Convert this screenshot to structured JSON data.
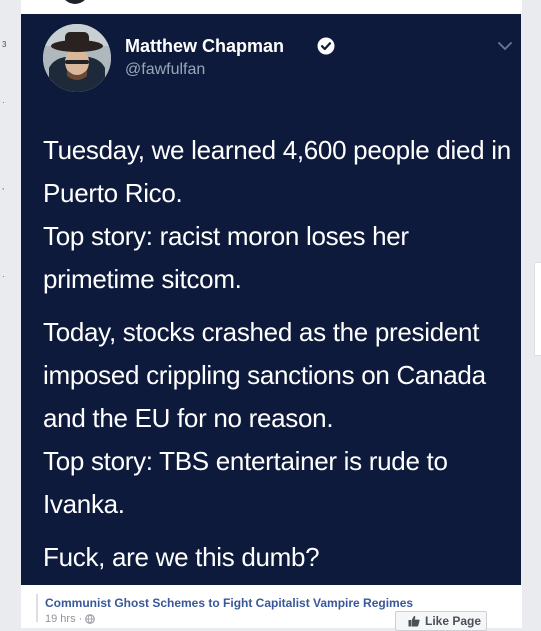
{
  "tweet": {
    "user": {
      "name": "Matthew Chapman",
      "handle": "@fawfulfan",
      "verified": true
    },
    "paragraphs": [
      "Tuesday, we learned 4,600 people died in Puerto Rico.\nTop story: racist moron loses her primetime sitcom.",
      "Today, stocks crashed as the president imposed crippling sanctions on Canada and the EU for no reason.\nTop story: TBS entertainer is rude to Ivanka.",
      "Fuck, are we this dumb?"
    ]
  },
  "post": {
    "page_name": "Communist Ghost Schemes to Fight Capitalist Vampire Regimes",
    "time": "19 hrs",
    "separator": "·",
    "like_button_label": "Like Page"
  },
  "colors": {
    "tweet_background": "#0d1a3b",
    "link": "#385898",
    "page_background": "#e9ebee"
  },
  "icons": [
    "verified-icon",
    "chevron-down-icon",
    "globe-icon",
    "thumbs-up-icon"
  ]
}
